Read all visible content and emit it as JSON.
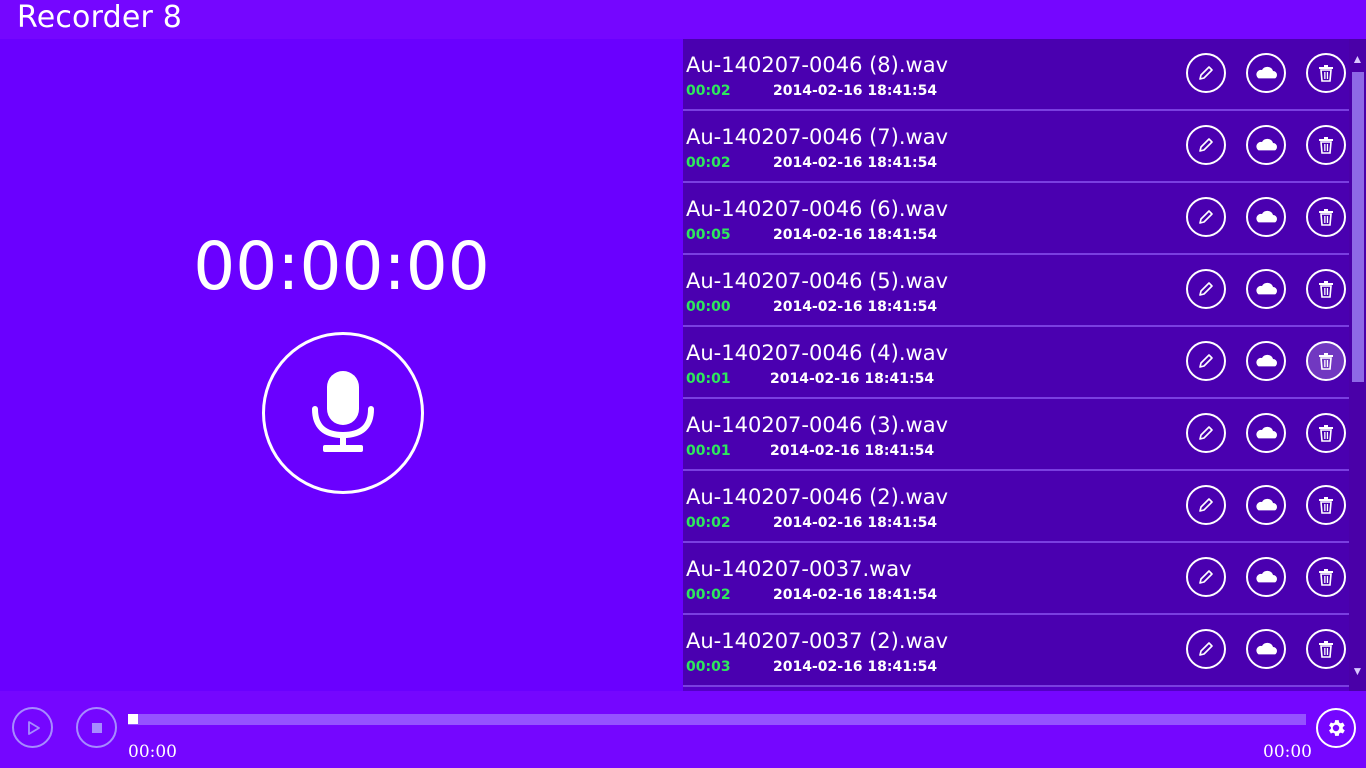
{
  "app": {
    "title": "Recorder 8"
  },
  "recorder": {
    "timer": "00:00:00"
  },
  "recordings": [
    {
      "name": "Au-140207-0046 (8).wav",
      "duration": "00:02",
      "date": "2014-02-16 18:41:54"
    },
    {
      "name": "Au-140207-0046 (7).wav",
      "duration": "00:02",
      "date": "2014-02-16 18:41:54"
    },
    {
      "name": "Au-140207-0046 (6).wav",
      "duration": "00:05",
      "date": "2014-02-16 18:41:54"
    },
    {
      "name": "Au-140207-0046 (5).wav",
      "duration": "00:00",
      "date": "2014-02-16 18:41:54"
    },
    {
      "name": "Au-140207-0046 (4).wav",
      "duration": "00:01",
      "date": "2014-02-16 18:41:54"
    },
    {
      "name": "Au-140207-0046 (3).wav",
      "duration": "00:01",
      "date": "2014-02-16 18:41:54"
    },
    {
      "name": "Au-140207-0046 (2).wav",
      "duration": "00:02",
      "date": "2014-02-16 18:41:54"
    },
    {
      "name": "Au-140207-0037.wav",
      "duration": "00:02",
      "date": "2014-02-16 18:41:54"
    },
    {
      "name": "Au-140207-0037 (2).wav",
      "duration": "00:03",
      "date": "2014-02-16 18:41:54"
    }
  ],
  "icons": {
    "record": "microphone-icon",
    "edit": "pencil-icon",
    "upload": "cloud-icon",
    "delete": "trash-icon",
    "play": "play-icon",
    "stop": "stop-icon",
    "settings": "gear-icon",
    "scroll_up": "chevron-up-icon",
    "scroll_down": "chevron-down-icon"
  },
  "player": {
    "elapsed": "00:00",
    "total": "00:00",
    "progress": 0
  },
  "colors": {
    "header_bg": "#7506ff",
    "main_bg": "#6a00ff",
    "list_item_bg": "#4a00b0",
    "duration_text": "#2ee85c",
    "text": "#ffffff"
  }
}
